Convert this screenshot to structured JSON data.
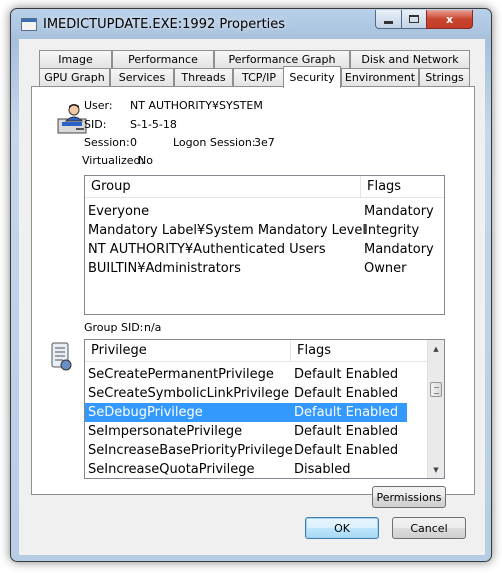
{
  "window": {
    "title": "IMEDICTUPDATE.EXE:1992 Properties",
    "controls": {
      "minimize_icon": "minimize-icon",
      "maximize_icon": "maximize-icon",
      "close_label": "x"
    }
  },
  "tabs_row_top": [
    "Image",
    "Performance",
    "Performance Graph",
    "Disk and Network"
  ],
  "tabs_row_bottom": [
    "GPU Graph",
    "Services",
    "Threads",
    "TCP/IP",
    "Security",
    "Environment",
    "Strings"
  ],
  "active_tab": "Security",
  "security": {
    "user_label": "User:",
    "user_value": "NT AUTHORITY¥SYSTEM",
    "sid_label": "SID:",
    "sid_value": "S-1-5-18",
    "session_label": "Session:",
    "session_value": "0",
    "logon_label": "Logon Session:",
    "logon_value": "3e7",
    "virtualized_label": "Virtualized:",
    "virtualized_value": "No",
    "groups": {
      "headers": [
        "Group",
        "Flags"
      ],
      "rows": [
        {
          "group": "Everyone",
          "flags": "Mandatory"
        },
        {
          "group": "Mandatory Label¥System Mandatory Level",
          "flags": "Integrity"
        },
        {
          "group": "NT AUTHORITY¥Authenticated Users",
          "flags": "Mandatory"
        },
        {
          "group": "BUILTIN¥Administrators",
          "flags": "Owner"
        }
      ]
    },
    "group_sid_label": "Group SID:",
    "group_sid_value": "n/a",
    "privileges": {
      "headers": [
        "Privilege",
        "Flags"
      ],
      "selected_index": 2,
      "rows": [
        {
          "privilege": "SeCreatePermanentPrivilege",
          "flags": "Default Enabled"
        },
        {
          "privilege": "SeCreateSymbolicLinkPrivilege",
          "flags": "Default Enabled"
        },
        {
          "privilege": "SeDebugPrivilege",
          "flags": "Default Enabled"
        },
        {
          "privilege": "SeImpersonatePrivilege",
          "flags": "Default Enabled"
        },
        {
          "privilege": "SeIncreaseBasePriorityPrivilege",
          "flags": "Default Enabled"
        },
        {
          "privilege": "SeIncreaseQuotaPrivilege",
          "flags": "Disabled"
        }
      ]
    },
    "permissions_button": "Permissions"
  },
  "buttons": {
    "ok": "OK",
    "cancel": "Cancel"
  },
  "colors": {
    "selection": "#3399ff",
    "close_button": "#c9462f"
  }
}
